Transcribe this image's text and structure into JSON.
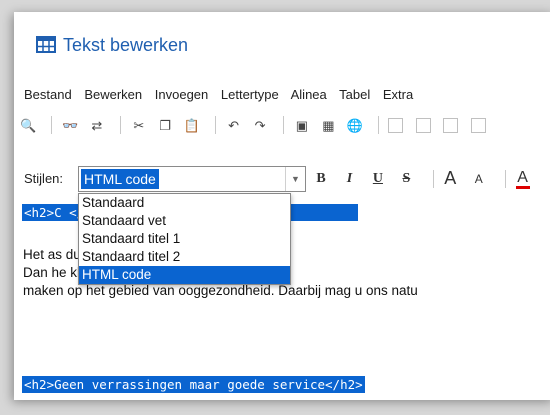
{
  "window": {
    "title": "Tekst bewerken"
  },
  "menu": [
    "Bestand",
    "Bewerken",
    "Invoegen",
    "Lettertype",
    "Alinea",
    "Tabel",
    "Extra"
  ],
  "styles": {
    "label": "Stijlen:",
    "selected": "HTML code",
    "options": [
      "Standaard",
      "Standaard vet",
      "Standaard titel 1",
      "Standaard titel 2",
      "HTML code"
    ]
  },
  "format": {
    "bold": "B",
    "italic": "I",
    "underline": "U",
    "strike": "S",
    "grow": "A",
    "shrink": "A",
    "color": "A"
  },
  "editor": {
    "code_line_1": "<h2>C                     </h2>",
    "lines": [
      "Het as                    ducten.nl biedt u oogverzorging i",
      "Dan he                    klikken van de muis wellicht al de",
      "maken op het gebied van ooggezondheid. Daarbij mag u ons natu"
    ],
    "code_line_2": "<h2>Geen verrassingen maar goede service</h2>"
  },
  "colors": {
    "accent": "#0a64d0",
    "title": "#1f5fb0"
  }
}
